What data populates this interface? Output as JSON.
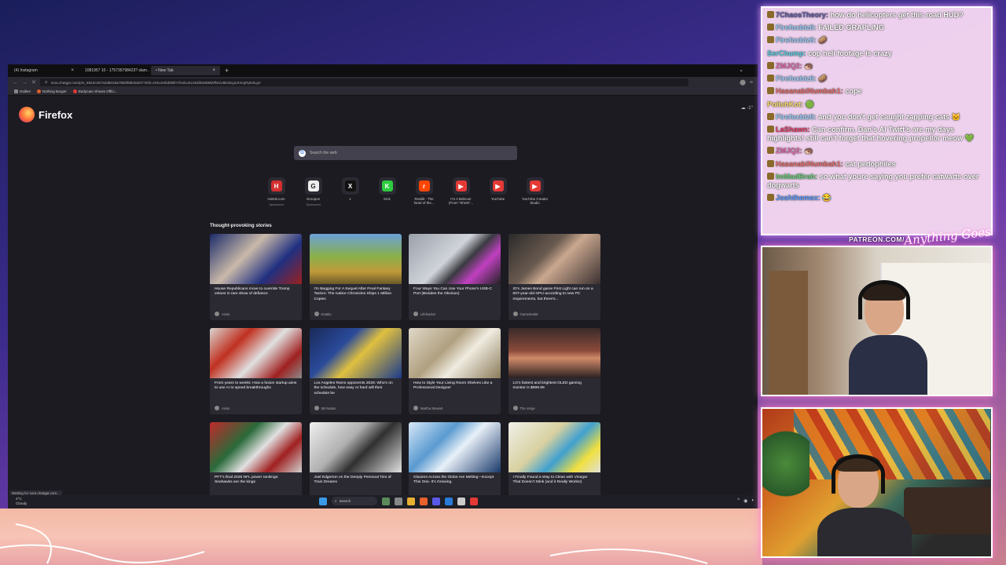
{
  "browser": {
    "tabs": [
      {
        "label": "(4) Instagram",
        "active": false
      },
      {
        "label": "1081957 10 - 175735798423? slam...",
        "active": false
      },
      {
        "label": "• New Tab",
        "active": true
      }
    ],
    "url": "sora.chatgpt.com/p/s_6922c25732d8019a78b6f98b26d47?shh=tXKv23hd0kkhYhmkUZL5DdbS8DBWfNUU6kGEg4JCKxjPpKdLgV",
    "bookmarks": [
      "Dailies",
      "Nothing Burger",
      "Bodycam Shows Offici..."
    ],
    "status_text": "Waiting for sora.chatgpt.com..."
  },
  "newtab": {
    "brand": "Firefox",
    "search_placeholder": "Search the web",
    "weather": "-1°",
    "shortcuts": [
      {
        "label": "Hotels.com",
        "sub": "Sponsored",
        "color": "#d32f2f",
        "glyph": "H"
      },
      {
        "label": "Groupon",
        "sub": "Sponsored",
        "color": "#eeeeee",
        "glyph": "G"
      },
      {
        "label": "x",
        "sub": "",
        "color": "#111111",
        "glyph": "X"
      },
      {
        "label": "Kick",
        "sub": "",
        "color": "#2ecc40",
        "glyph": "K"
      },
      {
        "label": "Reddit - The heart of the...",
        "sub": "",
        "color": "#ff4500",
        "glyph": "r"
      },
      {
        "label": "I'm A Believer (From \"Shrek\"...",
        "sub": "",
        "color": "#e53935",
        "glyph": "▶"
      },
      {
        "label": "YouTube",
        "sub": "",
        "color": "#e53935",
        "glyph": "▶"
      },
      {
        "label": "YouTube Creator Studio",
        "sub": "",
        "color": "#e53935",
        "glyph": "▶"
      }
    ],
    "stories_title": "Thought-provoking stories",
    "stories": [
      {
        "title": "House Republicans move to override Trump vetoes in rare show of defiance",
        "source": "Axios",
        "img": "linear-gradient(135deg,#1a2a6a 0%,#c9b9a9 40%,#203080 70%,#9a2020 100%)"
      },
      {
        "title": "I'm Begging For A Sequel After Final Fantasy Tactics: The Ivalice Chronicles Ships 1 Million Copies",
        "source": "Kotaku",
        "img": "linear-gradient(180deg,#6aa0d8 0%,#8ab04a 45%,#c09a3a 75%,#6a5a2a 100%)"
      },
      {
        "title": "Four Ways You Can Use Your Phone's USB-C Port (Besides the Obvious)",
        "source": "Lifehacker",
        "img": "linear-gradient(135deg,#9aa0aa 0%,#d0d4da 45%,#3a3a40 60%,#c040c0 75%,#222 100%)"
      },
      {
        "title": "IO's James Bond game First Light can run on a 007-year-old GPU according to new PC requirements, but there's...",
        "source": "Gamesradar",
        "img": "linear-gradient(135deg,#2a2a2a 0%,#6a5a50 40%,#c9a78e 55%,#3a3030 100%)"
      },
      {
        "title": "From years to weeks: How a fusion startup aims to use AI to speed breakthroughs",
        "source": "Axios",
        "img": "linear-gradient(135deg,#d9d4d0 0%,#c03020 30%,#e0e0e0 55%,#a02020 80%,#8a8a8a 100%)"
      },
      {
        "title": "Los Angeles Rams opponents 2026: Who's on the schedule, how easy or hard will their schedule be",
        "source": "SB Nation",
        "img": "linear-gradient(135deg,#1a2a5a 0%,#2a4a9a 35%,#e0c040 55%,#1a3a8a 100%)"
      },
      {
        "title": "How to Style Your Living Room Shelves Like a Professional Designer",
        "source": "Martha Stewart",
        "img": "linear-gradient(135deg,#e0d8c8 0%,#b0a080 40%,#f0ece0 60%,#8a7a5a 100%)"
      },
      {
        "title": "LG's fastest and brightest OLED gaming monitor is $999.99",
        "source": "The Verge",
        "img": "linear-gradient(180deg,#3a2a2a 0%,#8a4a3a 45%,#d08a6a 60%,#2a2020 100%)"
      },
      {
        "title": "PFT's final 2025 NFL power rankings: Seahawks are the kings",
        "source": "NBC Sports",
        "img": "linear-gradient(135deg,#c02a2a 0%,#2a6a3a 35%,#e0e0e0 55%,#a02020 75%,#d0d0d0 100%)"
      },
      {
        "title": "Joel Edgerton on the Deeply Personal Ties of Train Dreams",
        "source": "Vanity Fair",
        "img": "linear-gradient(135deg,#f0f0f0 0%,#b0b0b0 40%,#303030 60%,#e0e0e0 100%)"
      },
      {
        "title": "Glaciers Across the Globe Are Melting—Except This One. It's Growing.",
        "source": "Popular Mechanics",
        "img": "linear-gradient(135deg,#d8e8f8 0%,#5a9ad0 35%,#e8f0f8 55%,#1a3a6a 100%)"
      },
      {
        "title": "I Finally Found a Way to Clean with Vinegar That Doesn't Stink (and it Really Works!)",
        "source": "The Kitchn",
        "img": "linear-gradient(135deg,#f0f0e8 0%,#d8d0a0 40%,#40a0d0 60%,#f0e040 80%,#e0e0d8 100%)"
      }
    ]
  },
  "taskbar": {
    "weather_temp": "4°C",
    "weather_desc": "Cloudy",
    "search_label": "Search"
  },
  "chat": {
    "messages": [
      {
        "user": "7ChaosTheory:",
        "user_color": "#5f5aa8",
        "text": "how do helicopters get this road HUD?",
        "badge": true
      },
      {
        "user": "Firefoxbiz6:",
        "user_color": "#9ad0ff",
        "text": "FAILED GRAPLING",
        "badge": true
      },
      {
        "user": "Firefoxbiz6:",
        "user_color": "#9ad0ff",
        "text": "🥔",
        "badge": true
      },
      {
        "user": "SerChump:",
        "user_color": "#5ad0e8",
        "text": "cop heli footage is crazy",
        "badge": false
      },
      {
        "user": "ZMJQ2:",
        "user_color": "#e86ab0",
        "text": "🦔",
        "badge": true
      },
      {
        "user": "Firefoxbiz6:",
        "user_color": "#9ad0ff",
        "text": "🥔",
        "badge": true
      },
      {
        "user": "HasanabiNumbah1:",
        "user_color": "#e86a6a",
        "text": "cope",
        "badge": true
      },
      {
        "user": "PolishKot:",
        "user_color": "#ffe06a",
        "text": "🟢",
        "badge": false
      },
      {
        "user": "Firefoxbiz6:",
        "user_color": "#9ad0ff",
        "text": "and you don't get caught zapping cats 🐱",
        "badge": true
      },
      {
        "user": "LaShawn:",
        "user_color": "#e83a6a",
        "text": "Can confirm. Dan's AI Twitt's are my days highlights! still can't forget that hovering propellor meow 💚",
        "badge": true
      },
      {
        "user": "ZMJQ2:",
        "user_color": "#e86ab0",
        "text": "🦔",
        "badge": true
      },
      {
        "user": "HasanabiNumbah1:",
        "user_color": "#e86a6a",
        "text": "cat pedophiles",
        "badge": true
      },
      {
        "user": "ImMadBrah:",
        "user_color": "#6ad07a",
        "text": "so what youre saying you prefer catwarts over dogwarts",
        "badge": true
      },
      {
        "user": "Joshthemex:",
        "user_color": "#5a9aff",
        "text": "😂",
        "badge": true
      }
    ]
  },
  "overlay": {
    "patreon": "PATREON.COM/",
    "signature": "Anything Goes"
  }
}
